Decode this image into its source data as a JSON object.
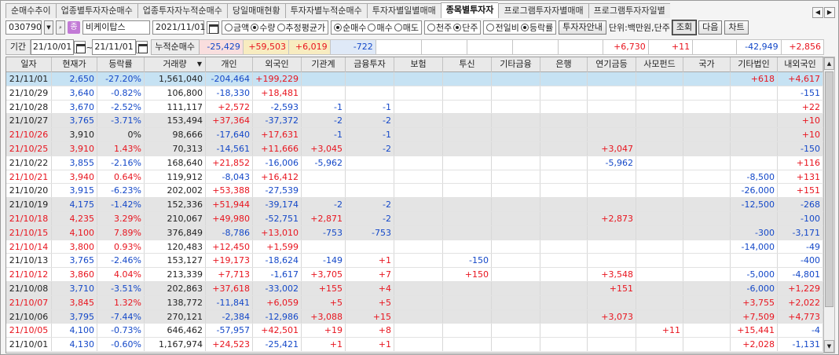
{
  "tabs": [
    "순매수추이",
    "업종별투자자순매수",
    "업종투자자누적순매수",
    "당일매매현황",
    "투자자별누적순매수",
    "투자자별일별매매",
    "종목별투자자",
    "프로그램투자자별매매",
    "프로그램투자자일별"
  ],
  "active_tab": 6,
  "toolbar": {
    "stock_code": "030790",
    "stock_icon_glyph": "종",
    "stock_name": "비케이탑스",
    "date": "2021/11/01",
    "unit_radios": [
      {
        "label": "금액",
        "on": false
      },
      {
        "label": "수량",
        "on": true
      },
      {
        "label": "추정평균가",
        "on": false
      }
    ],
    "trade_radios": [
      {
        "label": "순매수",
        "on": true
      },
      {
        "label": "매수",
        "on": false
      },
      {
        "label": "매도",
        "on": false
      }
    ],
    "share_radios": [
      {
        "label": "천주",
        "on": false
      },
      {
        "label": "단주",
        "on": true
      }
    ],
    "compare_radios": [
      {
        "label": "전일비",
        "on": false
      },
      {
        "label": "등락률",
        "on": true
      }
    ],
    "guide_button": "투자자안내",
    "unit_text": "단위:백만원,단주",
    "query_button": "조회",
    "next_button": "다음",
    "chart_button": "차트"
  },
  "period": {
    "label": "기간",
    "from": "21/10/01",
    "to": "21/11/01",
    "cum_label": "누적순매수",
    "cum_values": [
      "-25,429",
      "+59,503",
      "+6,019",
      "-722",
      "",
      "",
      "",
      "",
      "",
      "+6,730",
      "+11",
      "",
      "-42,949",
      "+2,856"
    ]
  },
  "columns": [
    "일자",
    "현재가",
    "등락률",
    "거래량",
    "개인",
    "외국인",
    "기관계",
    "금융투자",
    "보험",
    "투신",
    "기타금융",
    "은행",
    "연기금등",
    "사모펀드",
    "국가",
    "기타법인",
    "내외국인"
  ],
  "rows": [
    {
      "d": "21/11/01",
      "p": "2,650",
      "r": "-27.20%",
      "v": "1,561,040",
      "ind": "-204,464",
      "for": "+199,229",
      "inst": "",
      "fin": "",
      "ins": "",
      "inv": "",
      "oth": "",
      "bank": "",
      "pen": "",
      "pe": "",
      "gov": "",
      "corp": "+618",
      "dom": "+4,617",
      "sel": true,
      "shade": false
    },
    {
      "d": "21/10/29",
      "p": "3,640",
      "r": "-0.82%",
      "v": "106,800",
      "ind": "-18,330",
      "for": "+18,481",
      "inst": "",
      "fin": "",
      "ins": "",
      "inv": "",
      "oth": "",
      "bank": "",
      "pen": "",
      "pe": "",
      "gov": "",
      "corp": "",
      "dom": "-151",
      "sel": false,
      "shade": false
    },
    {
      "d": "21/10/28",
      "p": "3,670",
      "r": "-2.52%",
      "v": "111,117",
      "ind": "+2,572",
      "for": "-2,593",
      "inst": "-1",
      "fin": "-1",
      "ins": "",
      "inv": "",
      "oth": "",
      "bank": "",
      "pen": "",
      "pe": "",
      "gov": "",
      "corp": "",
      "dom": "+22",
      "sel": false,
      "shade": false
    },
    {
      "d": "21/10/27",
      "p": "3,765",
      "r": "-3.71%",
      "v": "153,494",
      "ind": "+37,364",
      "for": "-37,372",
      "inst": "-2",
      "fin": "-2",
      "ins": "",
      "inv": "",
      "oth": "",
      "bank": "",
      "pen": "",
      "pe": "",
      "gov": "",
      "corp": "",
      "dom": "+10",
      "sel": false,
      "shade": true
    },
    {
      "d": "21/10/26",
      "p": "3,910",
      "r": "0%",
      "v": "98,666",
      "ind": "-17,640",
      "for": "+17,631",
      "inst": "-1",
      "fin": "-1",
      "ins": "",
      "inv": "",
      "oth": "",
      "bank": "",
      "pen": "",
      "pe": "",
      "gov": "",
      "corp": "",
      "dom": "+10",
      "sel": false,
      "shade": true
    },
    {
      "d": "21/10/25",
      "p": "3,910",
      "r": "1.43%",
      "v": "70,313",
      "ind": "-14,561",
      "for": "+11,666",
      "inst": "+3,045",
      "fin": "-2",
      "ins": "",
      "inv": "",
      "oth": "",
      "bank": "",
      "pen": "+3,047",
      "pe": "",
      "gov": "",
      "corp": "",
      "dom": "-150",
      "sel": false,
      "shade": true
    },
    {
      "d": "21/10/22",
      "p": "3,855",
      "r": "-2.16%",
      "v": "168,640",
      "ind": "+21,852",
      "for": "-16,006",
      "inst": "-5,962",
      "fin": "",
      "ins": "",
      "inv": "",
      "oth": "",
      "bank": "",
      "pen": "-5,962",
      "pe": "",
      "gov": "",
      "corp": "",
      "dom": "+116",
      "sel": false,
      "shade": false
    },
    {
      "d": "21/10/21",
      "p": "3,940",
      "r": "0.64%",
      "v": "119,912",
      "ind": "-8,043",
      "for": "+16,412",
      "inst": "",
      "fin": "",
      "ins": "",
      "inv": "",
      "oth": "",
      "bank": "",
      "pen": "",
      "pe": "",
      "gov": "",
      "corp": "-8,500",
      "dom": "+131",
      "sel": false,
      "shade": false
    },
    {
      "d": "21/10/20",
      "p": "3,915",
      "r": "-6.23%",
      "v": "202,002",
      "ind": "+53,388",
      "for": "-27,539",
      "inst": "",
      "fin": "",
      "ins": "",
      "inv": "",
      "oth": "",
      "bank": "",
      "pen": "",
      "pe": "",
      "gov": "",
      "corp": "-26,000",
      "dom": "+151",
      "sel": false,
      "shade": false
    },
    {
      "d": "21/10/19",
      "p": "4,175",
      "r": "-1.42%",
      "v": "152,336",
      "ind": "+51,944",
      "for": "-39,174",
      "inst": "-2",
      "fin": "-2",
      "ins": "",
      "inv": "",
      "oth": "",
      "bank": "",
      "pen": "",
      "pe": "",
      "gov": "",
      "corp": "-12,500",
      "dom": "-268",
      "sel": false,
      "shade": true
    },
    {
      "d": "21/10/18",
      "p": "4,235",
      "r": "3.29%",
      "v": "210,067",
      "ind": "+49,980",
      "for": "-52,751",
      "inst": "+2,871",
      "fin": "-2",
      "ins": "",
      "inv": "",
      "oth": "",
      "bank": "",
      "pen": "+2,873",
      "pe": "",
      "gov": "",
      "corp": "",
      "dom": "-100",
      "sel": false,
      "shade": true
    },
    {
      "d": "21/10/15",
      "p": "4,100",
      "r": "7.89%",
      "v": "376,849",
      "ind": "-8,786",
      "for": "+13,010",
      "inst": "-753",
      "fin": "-753",
      "ins": "",
      "inv": "",
      "oth": "",
      "bank": "",
      "pen": "",
      "pe": "",
      "gov": "",
      "corp": "-300",
      "dom": "-3,171",
      "sel": false,
      "shade": true
    },
    {
      "d": "21/10/14",
      "p": "3,800",
      "r": "0.93%",
      "v": "120,483",
      "ind": "+12,450",
      "for": "+1,599",
      "inst": "",
      "fin": "",
      "ins": "",
      "inv": "",
      "oth": "",
      "bank": "",
      "pen": "",
      "pe": "",
      "gov": "",
      "corp": "-14,000",
      "dom": "-49",
      "sel": false,
      "shade": false
    },
    {
      "d": "21/10/13",
      "p": "3,765",
      "r": "-2.46%",
      "v": "153,127",
      "ind": "+19,173",
      "for": "-18,624",
      "inst": "-149",
      "fin": "+1",
      "ins": "",
      "inv": "-150",
      "oth": "",
      "bank": "",
      "pen": "",
      "pe": "",
      "gov": "",
      "corp": "",
      "dom": "-400",
      "sel": false,
      "shade": false
    },
    {
      "d": "21/10/12",
      "p": "3,860",
      "r": "4.04%",
      "v": "213,339",
      "ind": "+7,713",
      "for": "-1,617",
      "inst": "+3,705",
      "fin": "+7",
      "ins": "",
      "inv": "+150",
      "oth": "",
      "bank": "",
      "pen": "+3,548",
      "pe": "",
      "gov": "",
      "corp": "-5,000",
      "dom": "-4,801",
      "sel": false,
      "shade": false
    },
    {
      "d": "21/10/08",
      "p": "3,710",
      "r": "-3.51%",
      "v": "202,863",
      "ind": "+37,618",
      "for": "-33,002",
      "inst": "+155",
      "fin": "+4",
      "ins": "",
      "inv": "",
      "oth": "",
      "bank": "",
      "pen": "+151",
      "pe": "",
      "gov": "",
      "corp": "-6,000",
      "dom": "+1,229",
      "sel": false,
      "shade": true
    },
    {
      "d": "21/10/07",
      "p": "3,845",
      "r": "1.32%",
      "v": "138,772",
      "ind": "-11,841",
      "for": "+6,059",
      "inst": "+5",
      "fin": "+5",
      "ins": "",
      "inv": "",
      "oth": "",
      "bank": "",
      "pen": "",
      "pe": "",
      "gov": "",
      "corp": "+3,755",
      "dom": "+2,022",
      "sel": false,
      "shade": true
    },
    {
      "d": "21/10/06",
      "p": "3,795",
      "r": "-7.44%",
      "v": "270,121",
      "ind": "-2,384",
      "for": "-12,986",
      "inst": "+3,088",
      "fin": "+15",
      "ins": "",
      "inv": "",
      "oth": "",
      "bank": "",
      "pen": "+3,073",
      "pe": "",
      "gov": "",
      "corp": "+7,509",
      "dom": "+4,773",
      "sel": false,
      "shade": true
    },
    {
      "d": "21/10/05",
      "p": "4,100",
      "r": "-0.73%",
      "v": "646,462",
      "ind": "-57,957",
      "for": "+42,501",
      "inst": "+19",
      "fin": "+8",
      "ins": "",
      "inv": "",
      "oth": "",
      "bank": "",
      "pen": "",
      "pe": "+11",
      "gov": "",
      "corp": "+15,441",
      "dom": "-4",
      "sel": false,
      "shade": false
    },
    {
      "d": "21/10/01",
      "p": "4,130",
      "r": "-0.60%",
      "v": "1,167,974",
      "ind": "+24,523",
      "for": "-25,421",
      "inst": "+1",
      "fin": "+1",
      "ins": "",
      "inv": "",
      "oth": "",
      "bank": "",
      "pen": "",
      "pe": "",
      "gov": "",
      "corp": "+2,028",
      "dom": "-1,131",
      "sel": false,
      "shade": false
    }
  ],
  "prev_price_up_dates": [
    "21/10/26",
    "21/10/25",
    "21/10/21",
    "21/10/18",
    "21/10/15",
    "21/10/14",
    "21/10/12",
    "21/10/07",
    "21/10/05"
  ],
  "colors": {
    "up": "#e8141e",
    "down": "#1448c8",
    "selected_row": "#c6e2f3",
    "shaded_row": "#e4e4e4",
    "cum_individual": "#f9dede",
    "cum_foreign": "#f8ecc0",
    "cum_institution": "#f8ecc0",
    "cum_finance": "#dfe9f7"
  }
}
